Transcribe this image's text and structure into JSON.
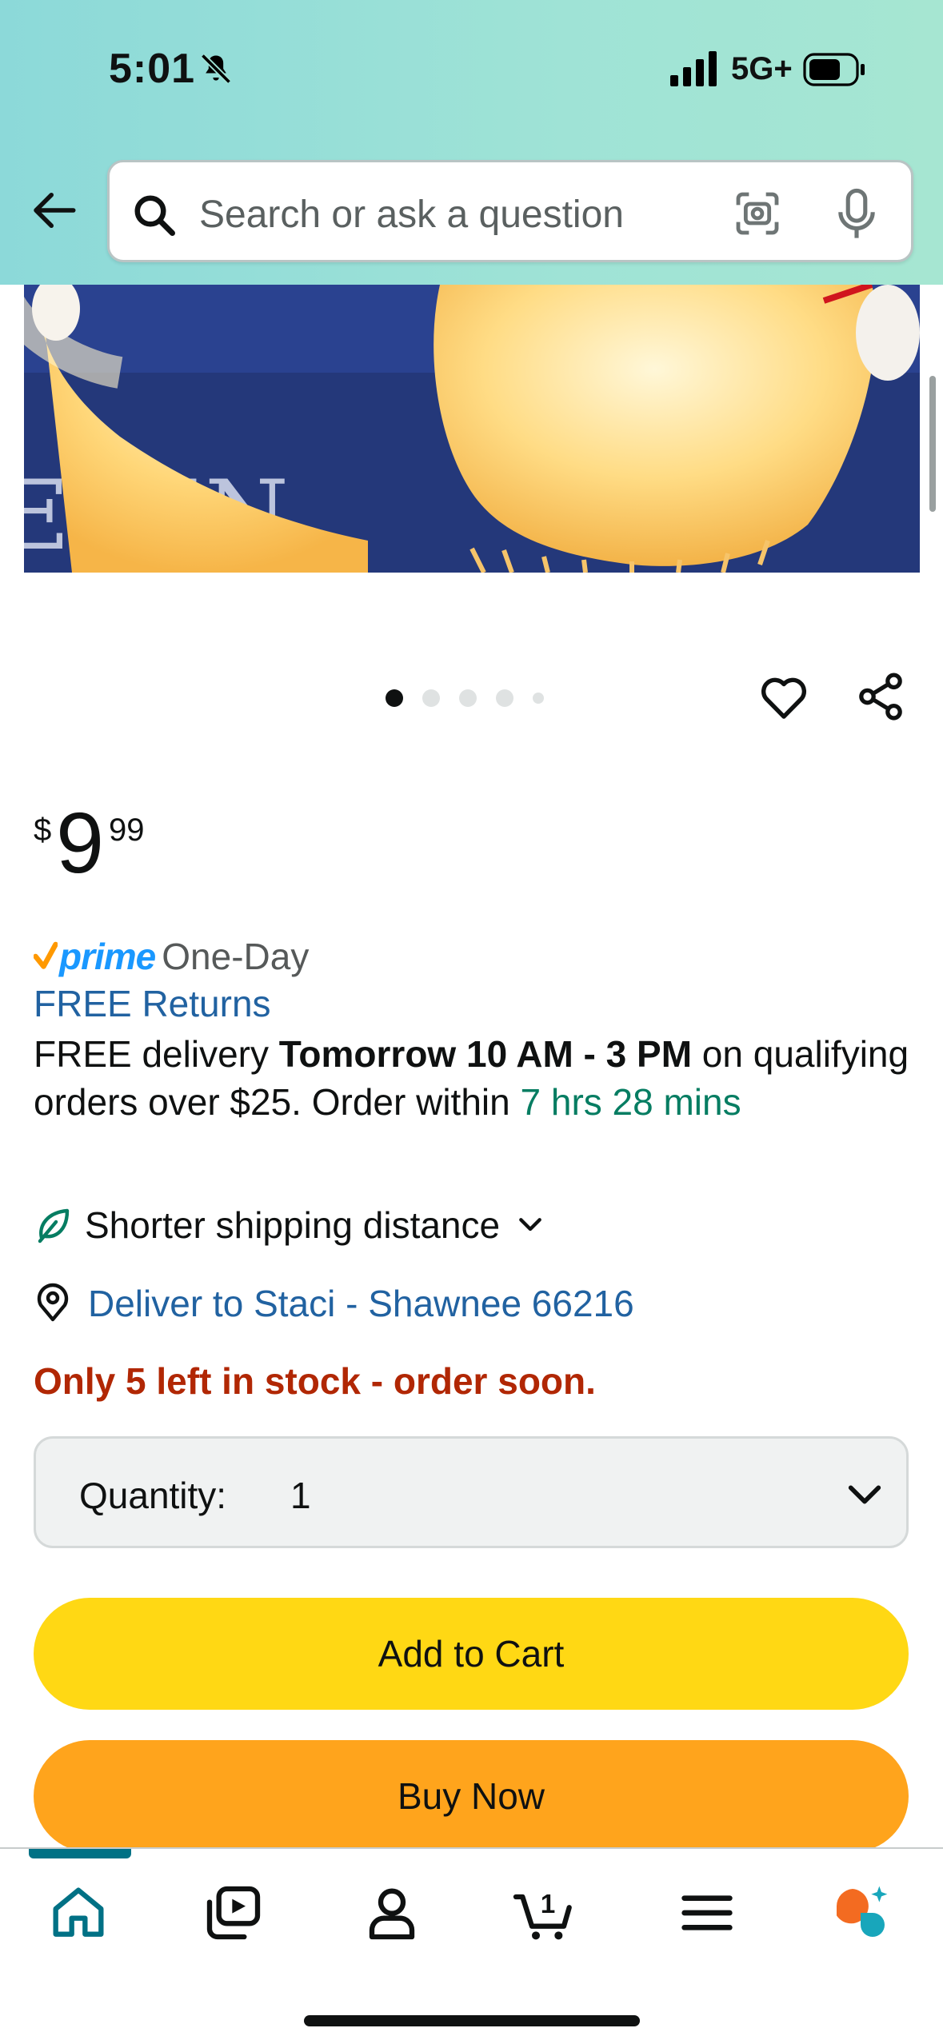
{
  "status_bar": {
    "time": "5:01",
    "network": "5G+"
  },
  "search": {
    "placeholder": "Search or ask a question"
  },
  "carousel": {
    "dot_count": 5,
    "active_index": 0
  },
  "product": {
    "price": {
      "currency": "$",
      "whole": "9",
      "fraction": "99"
    },
    "prime": {
      "word": "prime",
      "tier": "One-Day"
    },
    "returns": "FREE Returns",
    "delivery": {
      "prefix": "FREE delivery ",
      "window": "Tomorrow 10 AM - 3 PM",
      "middle": " on qualifying orders over $25. Order within ",
      "countdown": "7 hrs 28 mins"
    },
    "shipping_note": "Shorter shipping distance",
    "deliver_to": "Deliver to Staci - Shawnee 66216",
    "stock": "Only 5 left in stock - order soon.",
    "quantity": {
      "label": "Quantity:",
      "value": "1"
    }
  },
  "actions": {
    "add_to_cart": "Add to Cart",
    "buy_now": "Buy Now"
  },
  "bottom_nav": {
    "items": [
      "home-icon",
      "video-icon",
      "account-icon",
      "cart-icon",
      "menu-icon",
      "rufus-icon"
    ],
    "cart_count": "1",
    "active": "home"
  },
  "colors": {
    "link": "#2162a1",
    "prime": "#1a98ff",
    "countdown": "#067d62",
    "stock": "#b12704",
    "add_to_cart": "#ffd814",
    "buy_now": "#ffa41c",
    "nav_active": "#007185"
  }
}
